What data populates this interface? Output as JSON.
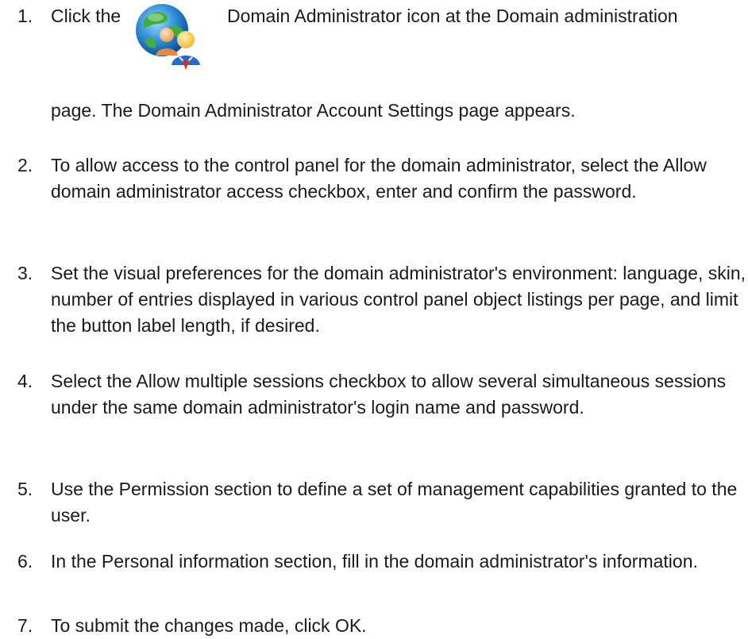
{
  "steps": [
    {
      "number": "1.",
      "text_before_icon": "Click the",
      "icon": "domain-administrator-icon",
      "text_after_icon": "Domain Administrator icon at the Domain administration",
      "text_continued": "page. The Domain Administrator Account Settings page appears."
    },
    {
      "number": "2.",
      "text": "To allow access to the control panel for the domain administrator, select the Allow domain administrator access checkbox, enter and confirm the password."
    },
    {
      "number": "3.",
      "text": "Set the visual preferences for the domain administrator's environment: language, skin, number of entries displayed in various control panel object listings per page, and limit the button label length, if desired."
    },
    {
      "number": "4.",
      "text": "Select the Allow multiple sessions checkbox to allow several simultaneous sessions under the same domain administrator's login name and password."
    },
    {
      "number": "5.",
      "text": "Use the Permission section to define a set of management capabilities granted to the user."
    },
    {
      "number": "6.",
      "text": "In the Personal information section, fill in the domain administrator's information."
    },
    {
      "number": "7.",
      "text": "To submit the changes made, click OK."
    }
  ]
}
